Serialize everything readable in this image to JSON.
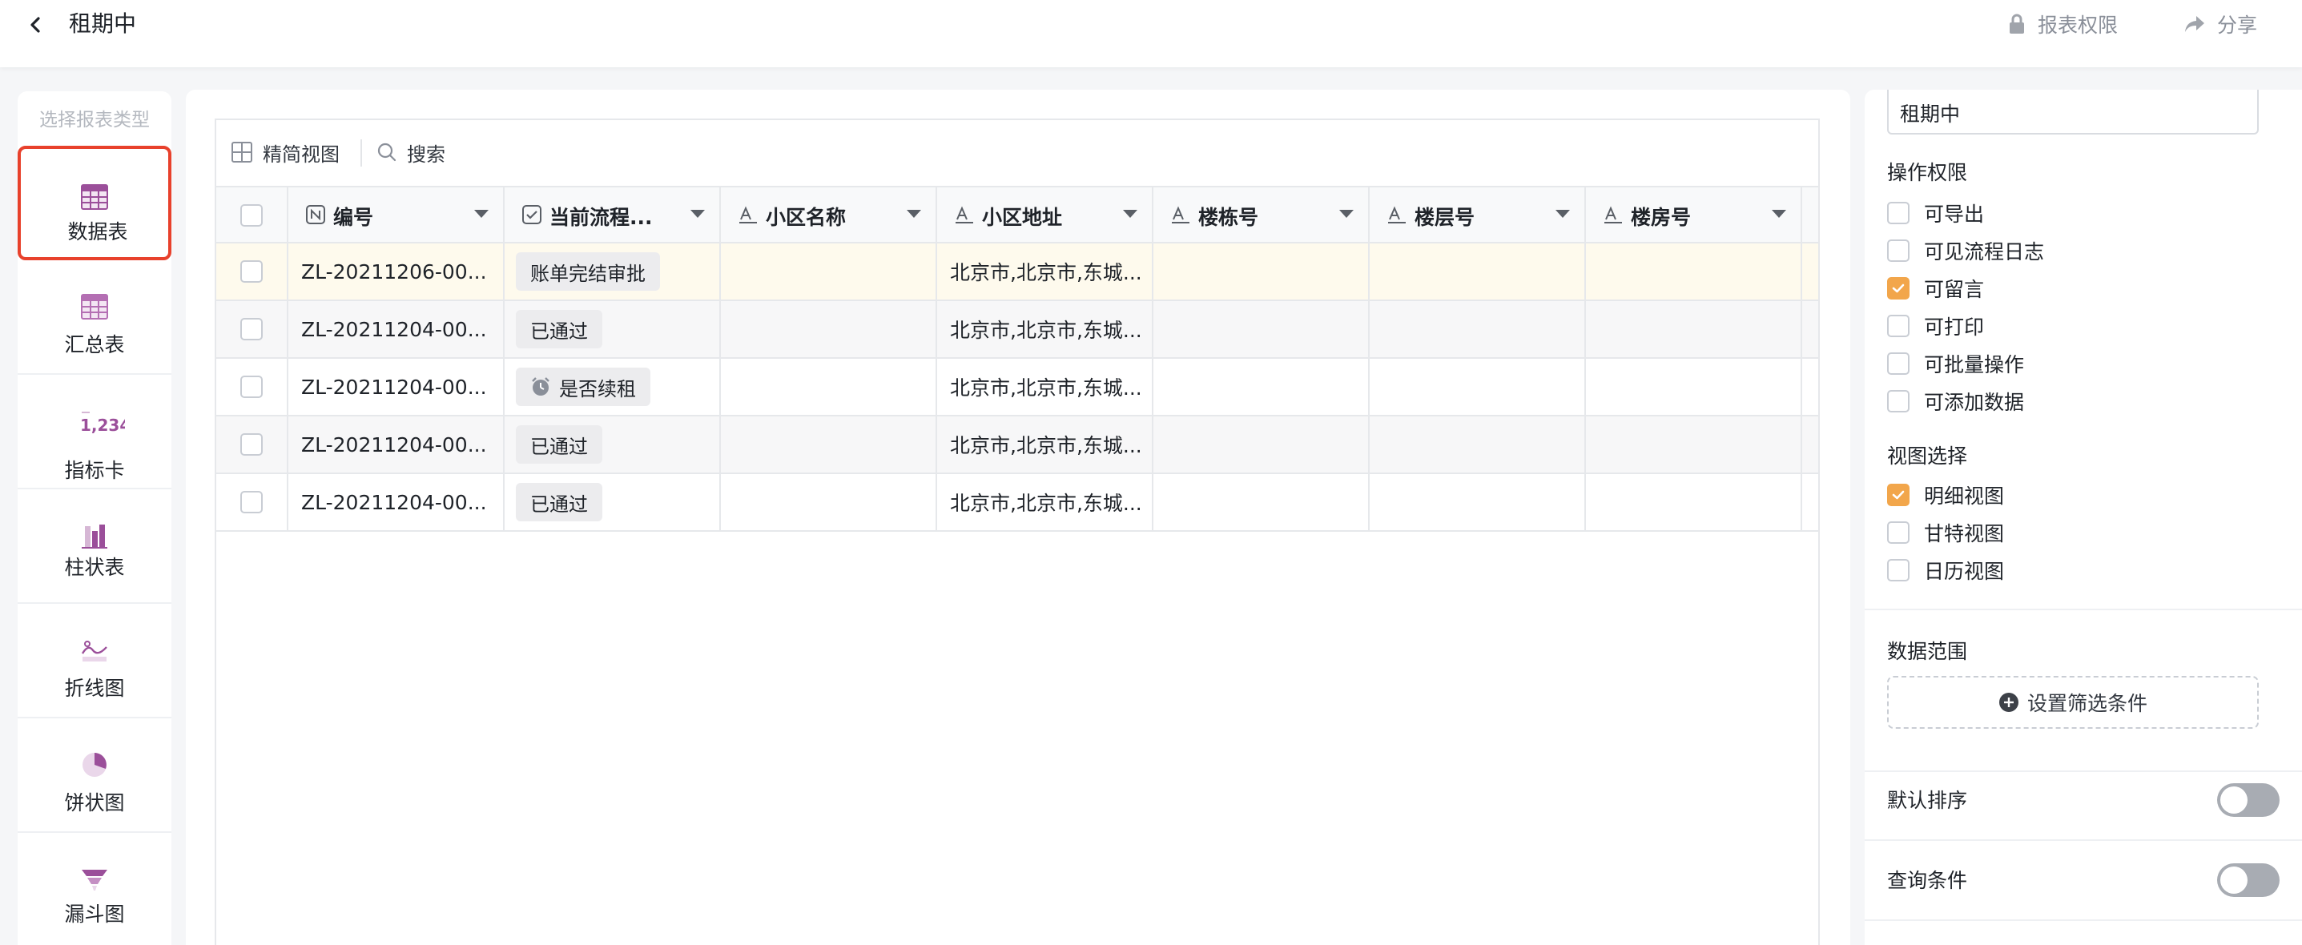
{
  "header": {
    "title": "租期中",
    "permissions_label": "报表权限",
    "share_label": "分享"
  },
  "report_types": {
    "hint": "选择报表类型",
    "items": [
      {
        "label": "数据表",
        "icon": "table-icon",
        "selected": true
      },
      {
        "label": "汇总表",
        "icon": "summary-table-icon",
        "selected": false
      },
      {
        "label": "指标卡",
        "icon": "metric-card-icon",
        "icon_text": "1,234",
        "selected": false
      },
      {
        "label": "柱状表",
        "icon": "bar-chart-icon",
        "selected": false
      },
      {
        "label": "折线图",
        "icon": "line-chart-icon",
        "selected": false
      },
      {
        "label": "饼状图",
        "icon": "pie-chart-icon",
        "selected": false
      },
      {
        "label": "漏斗图",
        "icon": "funnel-chart-icon",
        "selected": false
      }
    ]
  },
  "toolbar": {
    "view_label": "精简视图",
    "search_label": "搜索"
  },
  "table": {
    "columns": [
      {
        "label": "编号",
        "type_icon": "number-field-icon"
      },
      {
        "label": "当前流程...",
        "type_icon": "checkbox-field-icon"
      },
      {
        "label": "小区名称",
        "type_icon": "text-field-icon"
      },
      {
        "label": "小区地址",
        "type_icon": "text-field-icon"
      },
      {
        "label": "楼栋号",
        "type_icon": "text-field-icon"
      },
      {
        "label": "楼层号",
        "type_icon": "text-field-icon"
      },
      {
        "label": "楼房号",
        "type_icon": "text-field-icon"
      }
    ],
    "rows": [
      {
        "id": "ZL-20211206-00...",
        "status": "账单完结审批",
        "status_icon": null,
        "community": "",
        "address": "北京市,北京市,东城...",
        "building": "",
        "floor": "",
        "room": "",
        "highlight": true
      },
      {
        "id": "ZL-20211204-00...",
        "status": "已通过",
        "status_icon": null,
        "community": "",
        "address": "北京市,北京市,东城...",
        "building": "",
        "floor": "",
        "room": "",
        "highlight": false
      },
      {
        "id": "ZL-20211204-00...",
        "status": "是否续租",
        "status_icon": "alarm-clock-icon",
        "community": "",
        "address": "北京市,北京市,东城...",
        "building": "",
        "floor": "",
        "room": "",
        "highlight": false
      },
      {
        "id": "ZL-20211204-00...",
        "status": "已通过",
        "status_icon": null,
        "community": "",
        "address": "北京市,北京市,东城...",
        "building": "",
        "floor": "",
        "room": "",
        "highlight": false
      },
      {
        "id": "ZL-20211204-00...",
        "status": "已通过",
        "status_icon": null,
        "community": "",
        "address": "北京市,北京市,东城...",
        "building": "",
        "floor": "",
        "room": "",
        "highlight": false
      }
    ]
  },
  "settings": {
    "name_value": "租期中",
    "operation_title": "操作权限",
    "operations": [
      {
        "label": "可导出",
        "checked": false
      },
      {
        "label": "可见流程日志",
        "checked": false
      },
      {
        "label": "可留言",
        "checked": true
      },
      {
        "label": "可打印",
        "checked": false
      },
      {
        "label": "可批量操作",
        "checked": false
      },
      {
        "label": "可添加数据",
        "checked": false
      }
    ],
    "view_title": "视图选择",
    "views": [
      {
        "label": "明细视图",
        "checked": true
      },
      {
        "label": "甘特视图",
        "checked": false
      },
      {
        "label": "日历视图",
        "checked": false
      }
    ],
    "data_range_title": "数据范围",
    "filter_button": "设置筛选条件",
    "default_sort_label": "默认排序",
    "default_sort_on": false,
    "query_condition_label": "查询条件",
    "query_condition_on": false
  },
  "colors": {
    "accent_orange": "#f2a64b",
    "selected_border_red": "#e8412c",
    "icon_purple": "#9b4f9a",
    "row_highlight": "#fefaed",
    "row_alt": "#f7f7f8"
  }
}
